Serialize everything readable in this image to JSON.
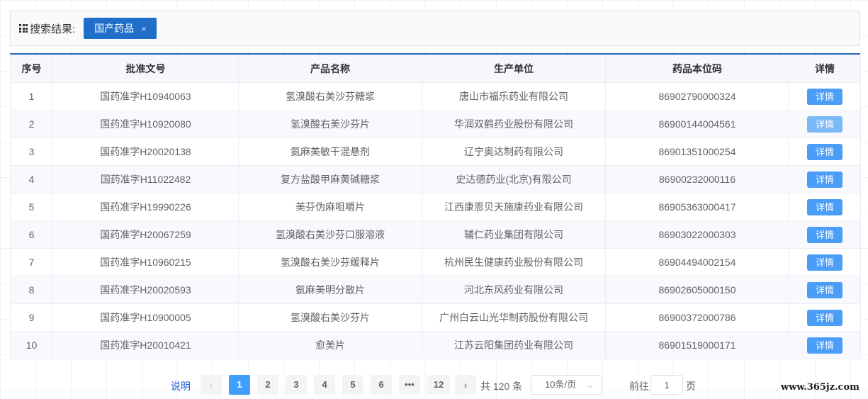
{
  "filter": {
    "label": "搜索结果:",
    "tag": "国产药品",
    "tag_close": "×"
  },
  "table": {
    "headers": [
      "序号",
      "批准文号",
      "产品名称",
      "生产单位",
      "药品本位码",
      "详情"
    ],
    "rows": [
      {
        "no": "1",
        "approval": "国药准字H10940063",
        "product": "氢溴酸右美沙芬糖浆",
        "maker": "唐山市福乐药业有限公司",
        "code": "86902790000324",
        "detail": "详情"
      },
      {
        "no": "2",
        "approval": "国药准字H10920080",
        "product": "氢溴酸右美沙芬片",
        "maker": "华润双鹤药业股份有限公司",
        "code": "86900144004561",
        "detail": "详情"
      },
      {
        "no": "3",
        "approval": "国药准字H20020138",
        "product": "氨麻美敏干混悬剂",
        "maker": "辽宁奥达制药有限公司",
        "code": "86901351000254",
        "detail": "详情"
      },
      {
        "no": "4",
        "approval": "国药准字H11022482",
        "product": "复方盐酸甲麻黄碱糖浆",
        "maker": "史达德药业(北京)有限公司",
        "code": "86900232000116",
        "detail": "详情"
      },
      {
        "no": "5",
        "approval": "国药准字H19990226",
        "product": "美芬伪麻咀嚼片",
        "maker": "江西康恩贝天施康药业有限公司",
        "code": "86905363000417",
        "detail": "详情"
      },
      {
        "no": "6",
        "approval": "国药准字H20067259",
        "product": "氢溴酸右美沙芬口服溶液",
        "maker": "辅仁药业集团有限公司",
        "code": "86903022000303",
        "detail": "详情"
      },
      {
        "no": "7",
        "approval": "国药准字H10960215",
        "product": "氢溴酸右美沙芬缓释片",
        "maker": "杭州民生健康药业股份有限公司",
        "code": "86904494002154",
        "detail": "详情"
      },
      {
        "no": "8",
        "approval": "国药准字H20020593",
        "product": "氨麻美明分散片",
        "maker": "河北东风药业有限公司",
        "code": "86902605000150",
        "detail": "详情"
      },
      {
        "no": "9",
        "approval": "国药准字H10900005",
        "product": "氢溴酸右美沙芬片",
        "maker": "广州白云山光华制药股份有限公司",
        "code": "86900372000786",
        "detail": "详情"
      },
      {
        "no": "10",
        "approval": "国药准字H20010421",
        "product": "愈美片",
        "maker": "江苏云阳集团药业有限公司",
        "code": "86901519000171",
        "detail": "详情"
      }
    ]
  },
  "pagination": {
    "help": "说明",
    "prev": "‹",
    "pages": [
      "1",
      "2",
      "3",
      "4",
      "5",
      "6",
      "•••",
      "12"
    ],
    "active_page": "1",
    "next": "›",
    "total": "共 120 条",
    "page_size": "10条/页",
    "goto_label": "前往",
    "goto_value": "1",
    "goto_suffix": "页"
  },
  "watermark": "www.365jz.com",
  "colors": {
    "accent": "#409eff",
    "tag": "#1f6fc9",
    "header_rule": "#2b6cb8"
  }
}
